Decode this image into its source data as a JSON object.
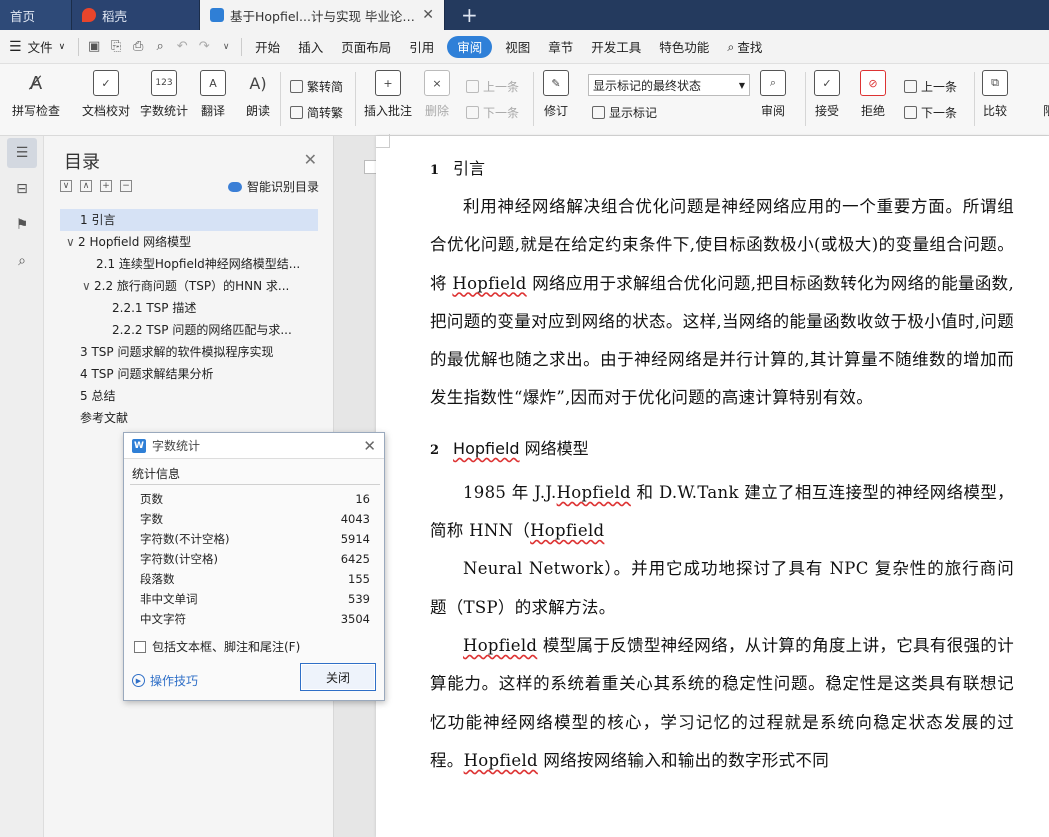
{
  "tabs": {
    "home": "首页",
    "daoke": "稻壳",
    "doc": "基于Hopfiel...计与实现 毕业论文个",
    "plus": "+"
  },
  "menubar": {
    "file": "文件",
    "items": [
      "开始",
      "插入",
      "页面布局",
      "引用",
      "审阅",
      "视图",
      "章节",
      "开发工具",
      "特色功能"
    ],
    "active": "审阅",
    "search": "查找"
  },
  "toolbar": {
    "spell": "拼写检查",
    "proof": "文档校对",
    "wordcount": "字数统计",
    "wordcount_icon_text": "123",
    "translate": "翻译",
    "read": "朗读",
    "trad": "繁转简",
    "simp": "简转繁",
    "insert_comment": "插入批注",
    "delete": "删除",
    "prev1": "上一条",
    "next1": "下一条",
    "revise": "修订",
    "markup_select": "显示标记的最终状态",
    "show_markup": "显示标记",
    "review": "审阅",
    "accept": "接受",
    "reject": "拒绝",
    "prev2": "上一条",
    "next2": "下一条",
    "compare": "比较",
    "limit": "限"
  },
  "toc": {
    "title": "目录",
    "smart": "智能识别目录",
    "items": [
      {
        "text": "1   引言",
        "level": 1
      },
      {
        "text": "2   Hopfield  网络模型",
        "level": 1
      },
      {
        "text": "2.1   连续型Hopfield神经网络模型结...",
        "level": 2
      },
      {
        "text": "2.2   旅行商问题（TSP）的HNN 求...",
        "level": 2
      },
      {
        "text": "2.2.1   TSP  描述",
        "level": 3
      },
      {
        "text": "2.2.2   TSP  问题的网络匹配与求...",
        "level": 3
      },
      {
        "text": "3   TSP 问题求解的软件模拟程序实现",
        "level": 1
      },
      {
        "text": "4   TSP 问题求解结果分析",
        "level": 1
      },
      {
        "text": "5   总结",
        "level": 1
      },
      {
        "text": "参考文献",
        "level": 1
      }
    ]
  },
  "dialog": {
    "title": "字数统计",
    "group": "统计信息",
    "stats": [
      {
        "label": "页数",
        "value": "16"
      },
      {
        "label": "字数",
        "value": "4043"
      },
      {
        "label": "字符数(不计空格)",
        "value": "5914"
      },
      {
        "label": "字符数(计空格)",
        "value": "6425"
      },
      {
        "label": "段落数",
        "value": "155"
      },
      {
        "label": "非中文单词",
        "value": "539"
      },
      {
        "label": "中文字符",
        "value": "3504"
      }
    ],
    "include": "包括文本框、脚注和尾注(F)",
    "tips": "操作技巧",
    "close": "关闭"
  },
  "document": {
    "h1_num": "1",
    "h1_text": "引言",
    "p1_a": "利用神经网络解决组合优化问题是神经网络应用的一个重要方面。所谓组合优化问题,就是在给定约束条件下,使目标函数极小(或极大)的变量组合问题。将 ",
    "p1_u": "Hopfield",
    "p1_b": " 网络应用于求解组合优化问题,把目标函数转化为网络的能量函数,把问题的变量对应到网络的状态。这样,当网络的能量函数收敛于极小值时,问题的最优解也随之求出。由于神经网络是并行计算的,其计算量不随维数的增加而发生指数性“爆炸”,因而对于优化问题的高速计算特别有效。",
    "h2_num": "2",
    "h2_u": "Hopfield",
    "h2_text": " 网络模型",
    "p2_a": "1985  年 J.J.",
    "p2_u1": "Hopfield",
    "p2_b": "  和 D.W.Tank  建立了相互连接型的神经网络模型，简称 HNN（",
    "p2_u2": "Hopfield",
    "p3": "Neural Network）。并用它成功地探讨了具有 NPC  复杂性的旅行商问题（TSP）的求解方法。",
    "p4_u": "Hopfield",
    "p4_a": " 模型属于反馈型神经网络，从计算的角度上讲，它具有很强的计算能力。这样的系统着重关心其系统的稳定性问题。稳定性是这类具有联想记忆功能神经网络模型的核心，学习记忆的过程就是系统向稳定状态发展的过程。",
    "p4_u2": "Hopfield",
    "p4_b": " 网络按网络输入和输出的数字形式不同"
  }
}
